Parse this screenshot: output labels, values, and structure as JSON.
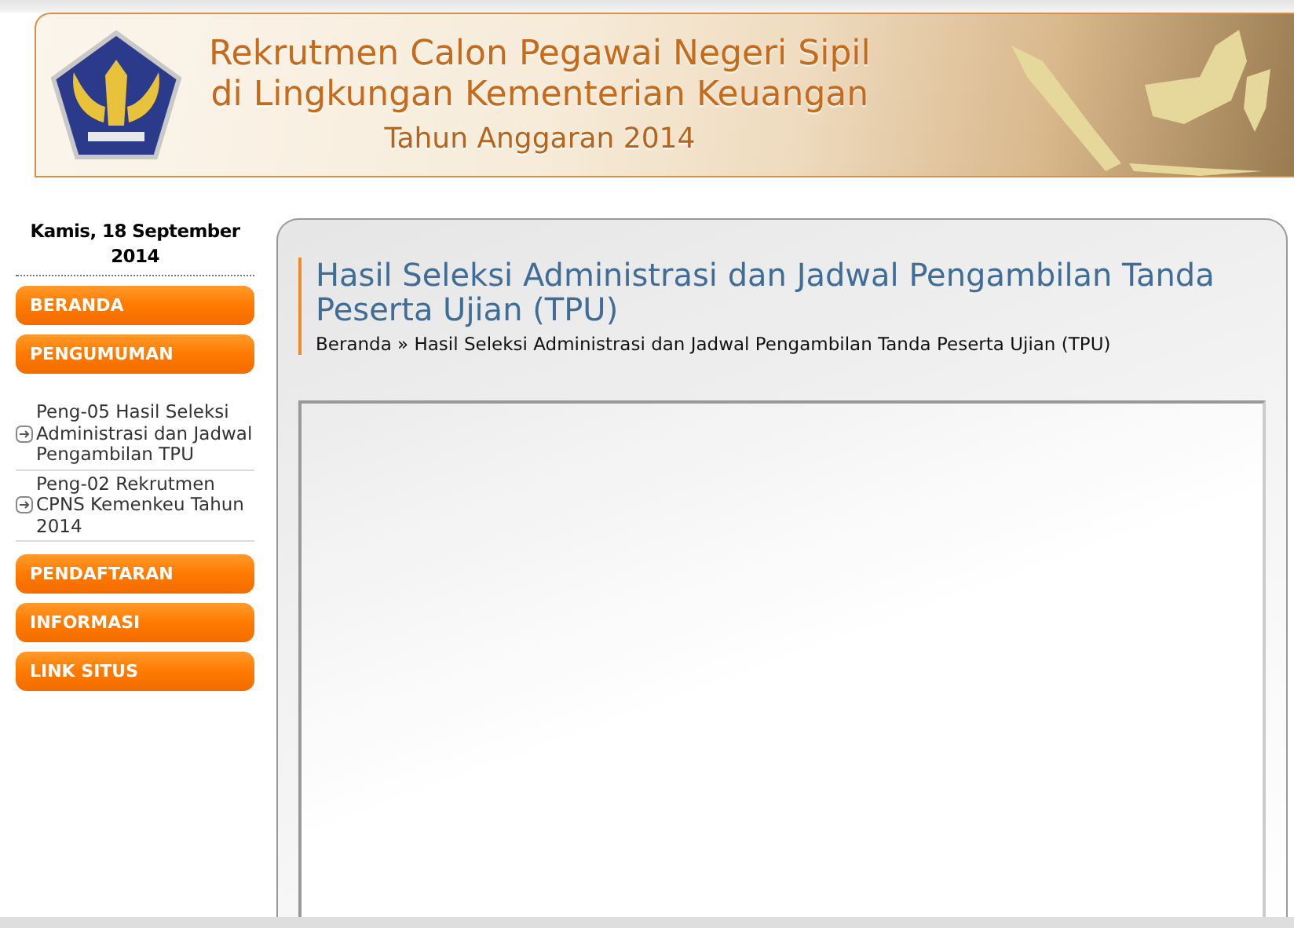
{
  "banner": {
    "title_lines": [
      "Rekrutmen Calon Pegawai Negeri Sipil",
      "di Lingkungan Kementerian Keuangan"
    ],
    "subtitle": "Tahun Anggaran 2014"
  },
  "sidebar": {
    "date": "Kamis, 18 September 2014",
    "menu": [
      {
        "label": "BERANDA"
      },
      {
        "label": "PENGUMUMAN",
        "children": [
          {
            "label": "Peng-05 Hasil Seleksi Administrasi dan Jadwal Pengambilan TPU"
          },
          {
            "label": "Peng-02 Rekrutmen CPNS Kemenkeu Tahun 2014"
          }
        ]
      },
      {
        "label": "PENDAFTARAN"
      },
      {
        "label": "INFORMASI"
      },
      {
        "label": "LINK SITUS"
      }
    ]
  },
  "content": {
    "title": "Hasil Seleksi Administrasi dan Jadwal Pengambilan Tanda Peserta Ujian (TPU)",
    "breadcrumb": "Beranda » Hasil Seleksi Administrasi dan Jadwal Pengambilan Tanda Peserta Ujian (TPU)"
  }
}
